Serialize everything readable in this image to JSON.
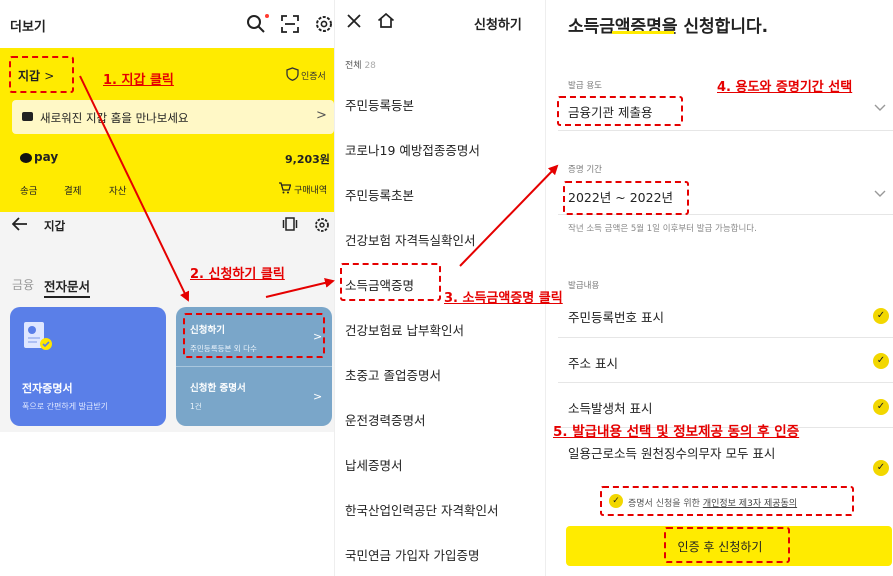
{
  "wallet_panel": {
    "header_title": "더보기",
    "wallet_link": "지갑",
    "cert_label": "인증서",
    "notice": "새로워진 지갑 홈을 만나보세요",
    "pay_label": "pay",
    "balance": "9,203원",
    "actions": [
      "송금",
      "결제",
      "자산"
    ],
    "orders": "구매내역",
    "sub_title": "지갑",
    "tabs": [
      "금융",
      "전자문서"
    ],
    "card_blue_title": "전자증명서",
    "card_blue_sub": "폭으로 간편하게 발급받기",
    "card_apply_title": "신청하기",
    "card_apply_sub": "주민등록등본 외 다수",
    "card_applied_title": "신청한 증명서",
    "card_applied_sub": "1건"
  },
  "list_panel": {
    "title": "신청하기",
    "all_label": "전체",
    "all_count": "28",
    "items": [
      "주민등록등본",
      "코로나19 예방접종증명서",
      "주민등록초본",
      "건강보험 자격득실확인서",
      "소득금액증명",
      "건강보험료 납부확인서",
      "초중고 졸업증명서",
      "운전경력증명서",
      "납세증명서",
      "한국산업인력공단 자격확인서",
      "국민연금 가입자 가입증명"
    ]
  },
  "form_panel": {
    "title": "소득금액증명을 신청합니다.",
    "purpose_label": "발급 용도",
    "purpose_value": "금융기관 제출용",
    "period_label": "증명 기간",
    "period_value": "2022년 ~ 2022년",
    "period_note": "작년 소득 금액은 5월 1일 이후부터 발급 가능합니다.",
    "contents_label": "발급내용",
    "options": [
      "주민등록번호 표시",
      "주소 표시",
      "소득발생처 표시",
      "일용근로소득 원천징수의무자 모두 표시"
    ],
    "consent_text": "증명서 신청을 위한 ",
    "consent_link": "개인정보 제3자 제공동의",
    "submit": "인증 후 신청하기"
  },
  "annotations": {
    "step1": "1. 지갑 클릭",
    "step2": "2. 신청하기 클릭",
    "step3": "3. 소득금액증명 클릭",
    "step4": "4. 용도와 증명기간 선택",
    "step5": "5. 발급내용 선택 및 정보제공 동의 후 인증"
  },
  "colors": {
    "kakao_yellow": "#ffeb00",
    "annotation_red": "#e50000",
    "card_blue": "#5a7fe8",
    "card_teal": "#7aa6c9"
  }
}
